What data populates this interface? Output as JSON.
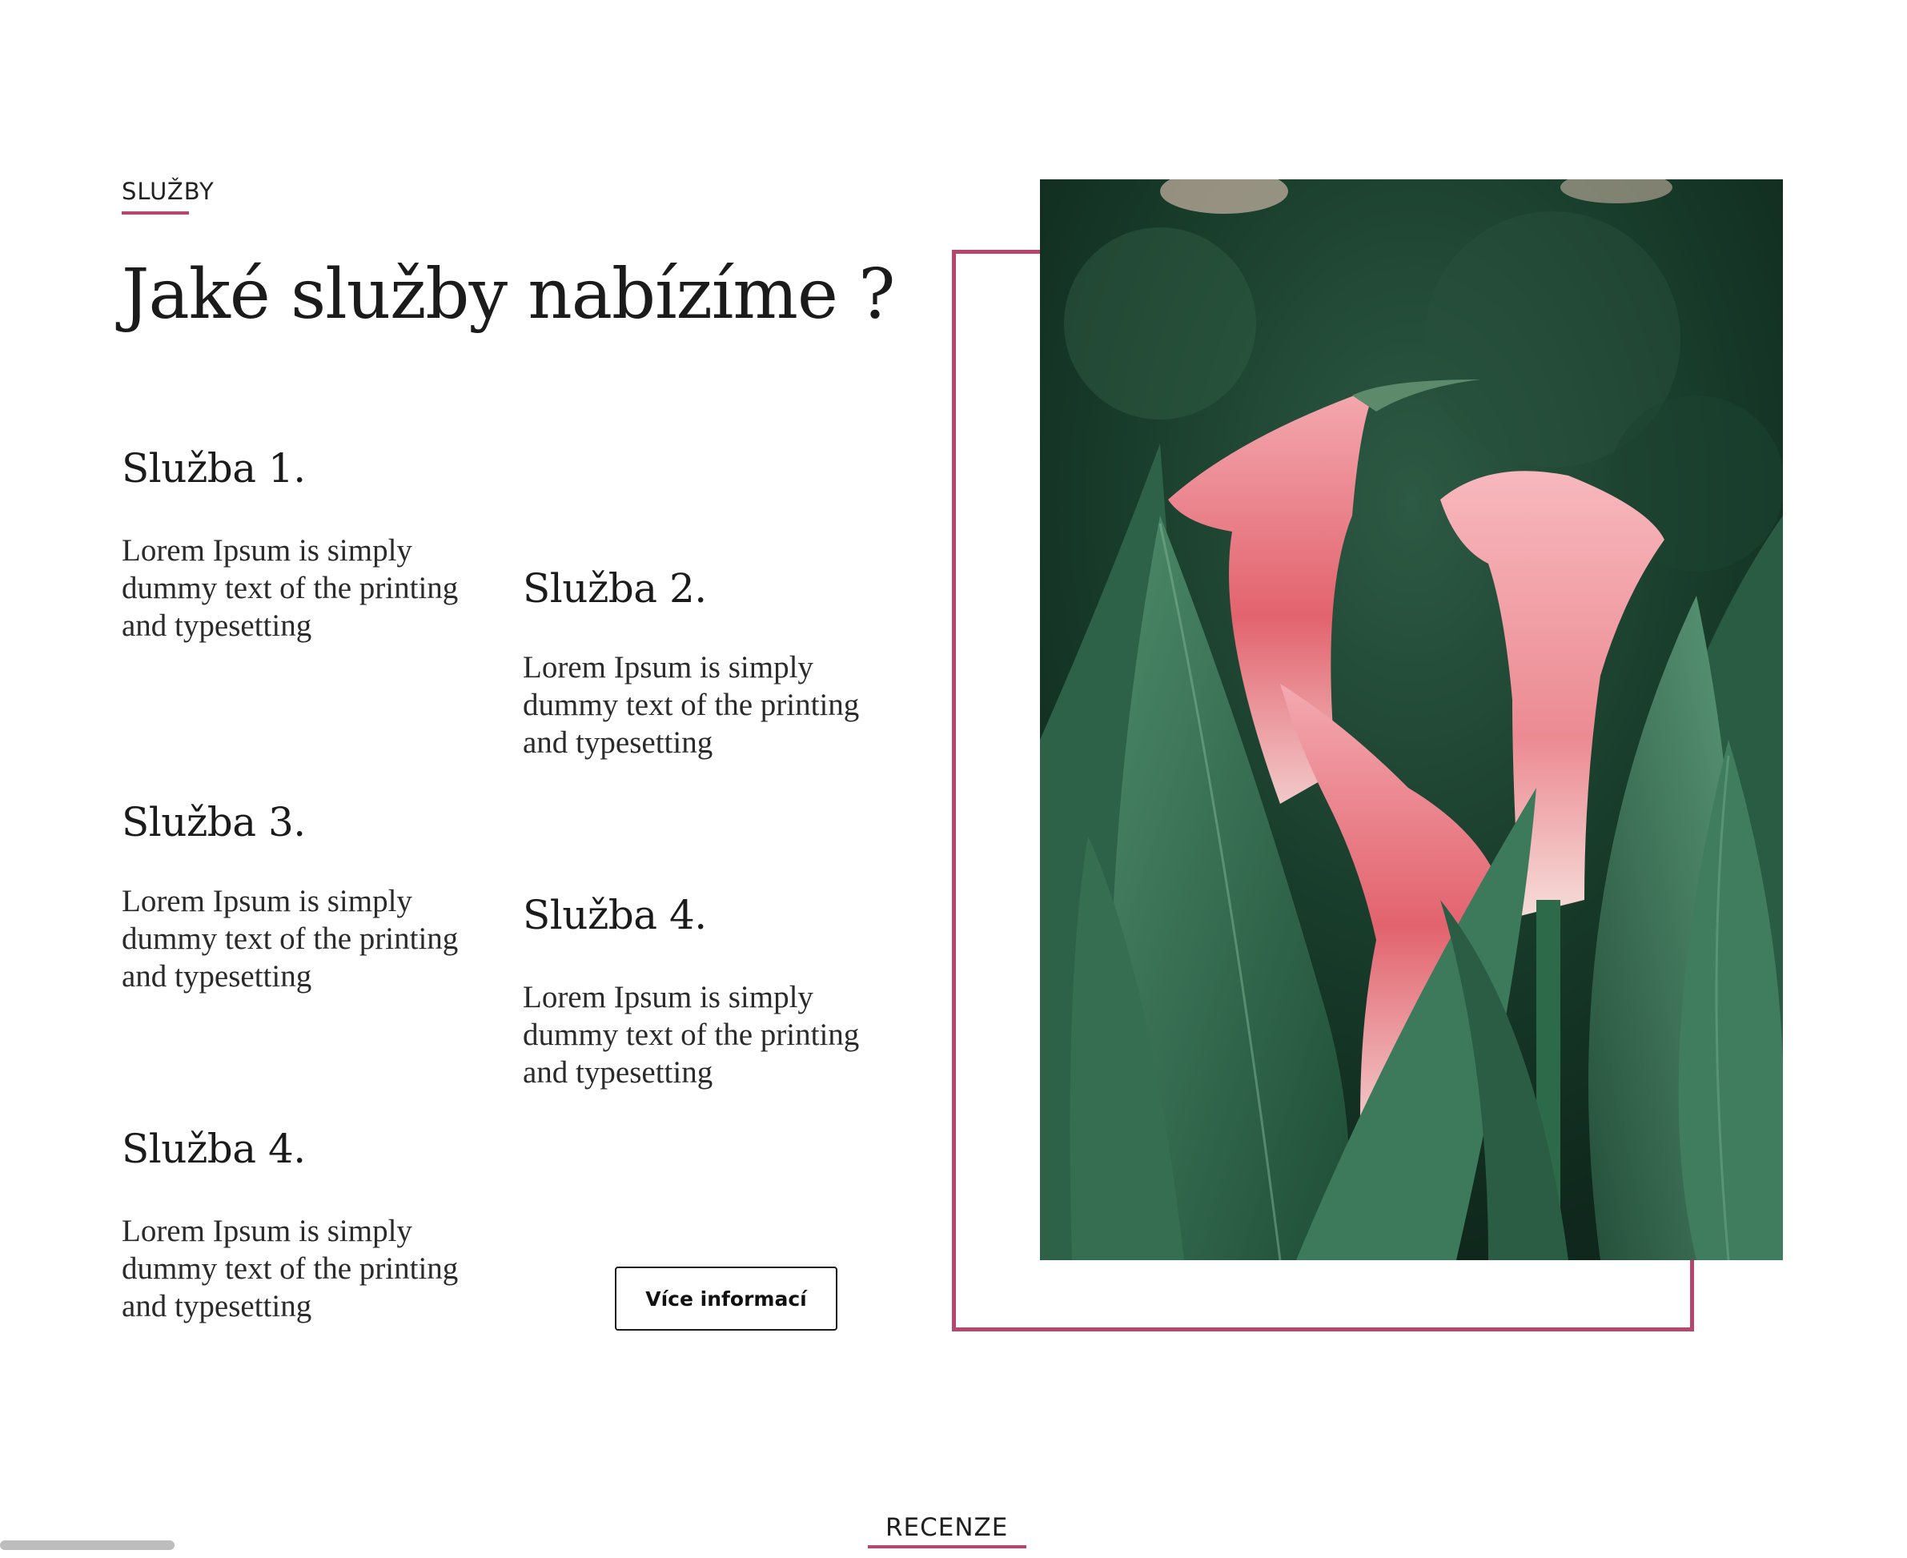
{
  "section": {
    "label": "SLUŽBY",
    "title": "Jaké služby nabízíme ?"
  },
  "services": [
    {
      "title": "Služba 1.",
      "text": "Lorem Ipsum is simply dummy text of the printing and typesetting"
    },
    {
      "title": "Služba 2.",
      "text": "Lorem Ipsum is simply dummy text of the printing and typesetting"
    },
    {
      "title": "Služba 3.",
      "text": "Lorem Ipsum is simply dummy text of the printing and typesetting"
    },
    {
      "title": "Služba 4.",
      "text": "Lorem Ipsum is simply dummy text of the printing and typesetting"
    },
    {
      "title": "Služba 4.",
      "text": "Lorem Ipsum is simply dummy text of the printing and typesetting"
    }
  ],
  "button": {
    "label": "Více informací"
  },
  "image": {
    "icon": "calla-lily-photo"
  },
  "next_section": {
    "label": "RECENZE"
  },
  "colors": {
    "accent": "#b8456c",
    "text": "#1b1b1b",
    "background": "#ffffff"
  }
}
